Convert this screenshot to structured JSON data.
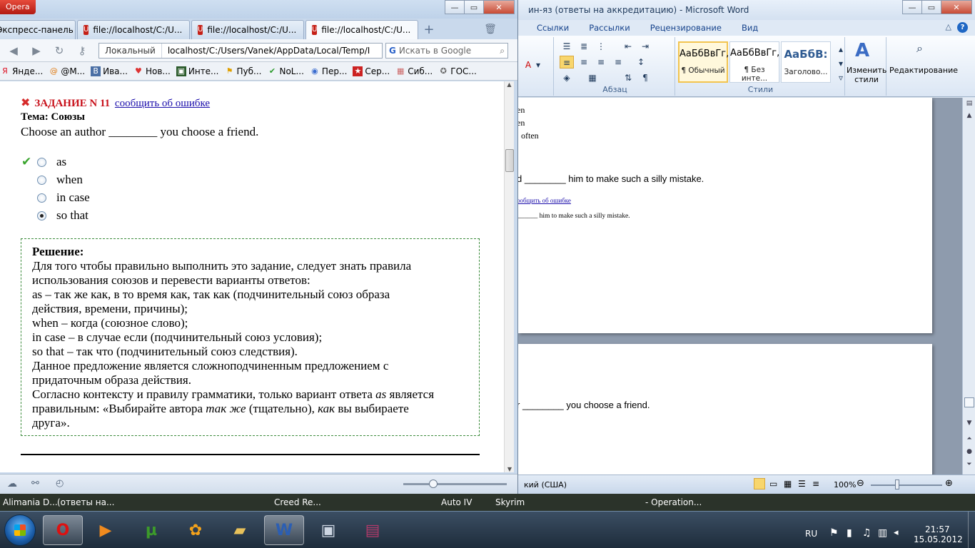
{
  "word": {
    "title": "ин-яз (ответы на аккредитацию)  -  Microsoft Word",
    "ribbon_tabs": [
      "Ссылки",
      "Рассылки",
      "Рецензирование",
      "Вид"
    ],
    "group_paragraph": "Абзац",
    "group_styles": "Стили",
    "styles": [
      {
        "sample": "АаБбВвГг,",
        "name": "¶ Обычный"
      },
      {
        "sample": "АаБбВвГг,",
        "name": "¶ Без инте..."
      },
      {
        "sample": "АаБбВ:",
        "name": "Заголово..."
      }
    ],
    "change_styles": "Изменить стили",
    "editing": "Редактирование",
    "page1_lines": [
      "en",
      "en",
      "often",
      "d ________ him to make such a silly mistake.",
      "сообщить об ошибке",
      "_______ him to make such a silly mistake."
    ],
    "page2_line": "r ________ you choose a friend.",
    "status_lang": "кий (США)",
    "zoom": "100%"
  },
  "browser": {
    "app": "Opera",
    "tabs": [
      {
        "label": "Экспресс-панель"
      },
      {
        "label": "file://localhost/C:/U..."
      },
      {
        "label": "file://localhost/C:/U..."
      },
      {
        "label": "file://localhost/C:/U..."
      }
    ],
    "address_local": "Локальный",
    "address_url": "localhost/C:/Users/Vanek/AppData/Local/Temp/I",
    "search_placeholder": "Искать в Google",
    "bookmarks": [
      "Янде...",
      "@M...",
      "Ива...",
      "Нов...",
      "Инте...",
      "Пуб...",
      "NoL...",
      "Пер...",
      "Сер...",
      "Сиб...",
      "ГОС..."
    ]
  },
  "page": {
    "task_title": "ЗАДАНИЕ N 11",
    "report_link": "сообщить об ошибке",
    "topic": "Тема: Союзы",
    "question": "Choose an author ________ you choose a friend.",
    "options": [
      "as",
      "when",
      "in case",
      "so that"
    ],
    "solution_title": "Решение:",
    "solution_lines": [
      "Для того чтобы правильно выполнить это задание, следует знать правила",
      "использования союзов и перевести варианты ответов:",
      "as – так же как, в то время как, так как (подчинительный союз образа",
      "действия, времени, причины);",
      "when – когда (союзное слово);",
      "in case – в случае если (подчинительный союз условия);",
      "so that – так что (подчинительный союз следствия).",
      "Данное предложение является сложноподчиненным предложением с",
      "придаточным образа действия."
    ],
    "final_1": "Согласно контексту и правилу грамматики, только вариант ответа ",
    "final_as": "as",
    "final_2": " является",
    "final_3": "правильным: «Выбирайте автора ",
    "final_tak": "так же",
    "final_4": " (тщательно), ",
    "final_kak": "как",
    "final_5": " вы выбираете",
    "final_6": "друга»."
  },
  "taskrow": [
    "Alimania D...",
    "(ответы на...",
    "Creed Re...",
    "Auto IV",
    "Skyrim",
    "- Operation..."
  ],
  "tray": {
    "lang": "RU",
    "time": "21:57",
    "date": "15.05.2012"
  }
}
